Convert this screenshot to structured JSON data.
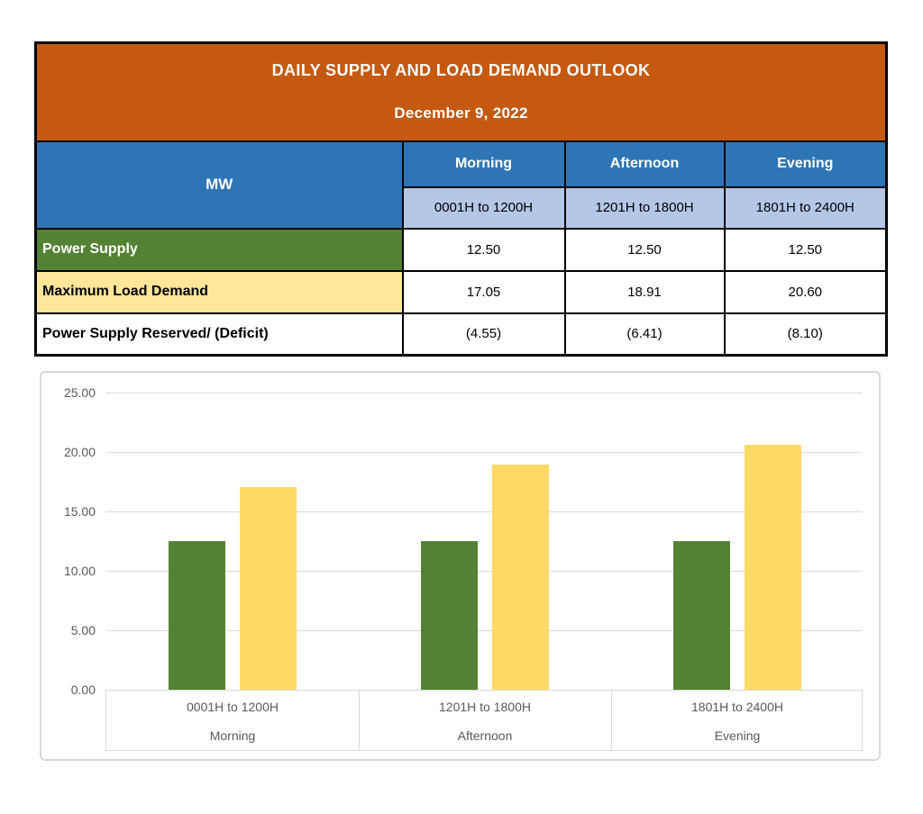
{
  "colors": {
    "header_orange": "#C5590F",
    "header_blue": "#2E75B6",
    "subheader_blue": "#B4C7E7",
    "row_green": "#548235",
    "row_yellow": "#FFE699",
    "bar_green": "#548235",
    "bar_yellow": "#FFD966",
    "gridline": "#D9D9D9",
    "axis_text": "#595959"
  },
  "table": {
    "title": "DAILY SUPPLY AND LOAD DEMAND OUTLOOK",
    "date": "December 9, 2022",
    "unit_header": "MW",
    "period_headers": [
      "Morning",
      "Afternoon",
      "Evening"
    ],
    "time_headers": [
      "0001H to 1200H",
      "1201H to 1800H",
      "1801H to 2400H"
    ],
    "rows": [
      {
        "label": "Power Supply",
        "values": [
          "12.50",
          "12.50",
          "12.50"
        ]
      },
      {
        "label": "Maximum Load Demand",
        "values": [
          "17.05",
          "18.91",
          "20.60"
        ]
      },
      {
        "label": "Power Supply Reserved/ (Deficit)",
        "values": [
          "(4.55)",
          "(6.41)",
          "(8.10)"
        ]
      }
    ]
  },
  "chart_data": {
    "type": "bar",
    "title": "",
    "categories": [
      {
        "time": "0001H to 1200H",
        "period": "Morning"
      },
      {
        "time": "1201H to 1800H",
        "period": "Afternoon"
      },
      {
        "time": "1801H to 2400H",
        "period": "Evening"
      }
    ],
    "series": [
      {
        "name": "Power Supply",
        "color": "#548235",
        "values": [
          12.5,
          12.5,
          12.5
        ]
      },
      {
        "name": "Maximum Load Demand",
        "color": "#FFD966",
        "values": [
          17.05,
          18.91,
          20.6
        ]
      }
    ],
    "ylim": [
      0,
      25
    ],
    "ytick_step": 5,
    "ytick_decimals": 2,
    "grid": true,
    "legend_position": "none"
  }
}
